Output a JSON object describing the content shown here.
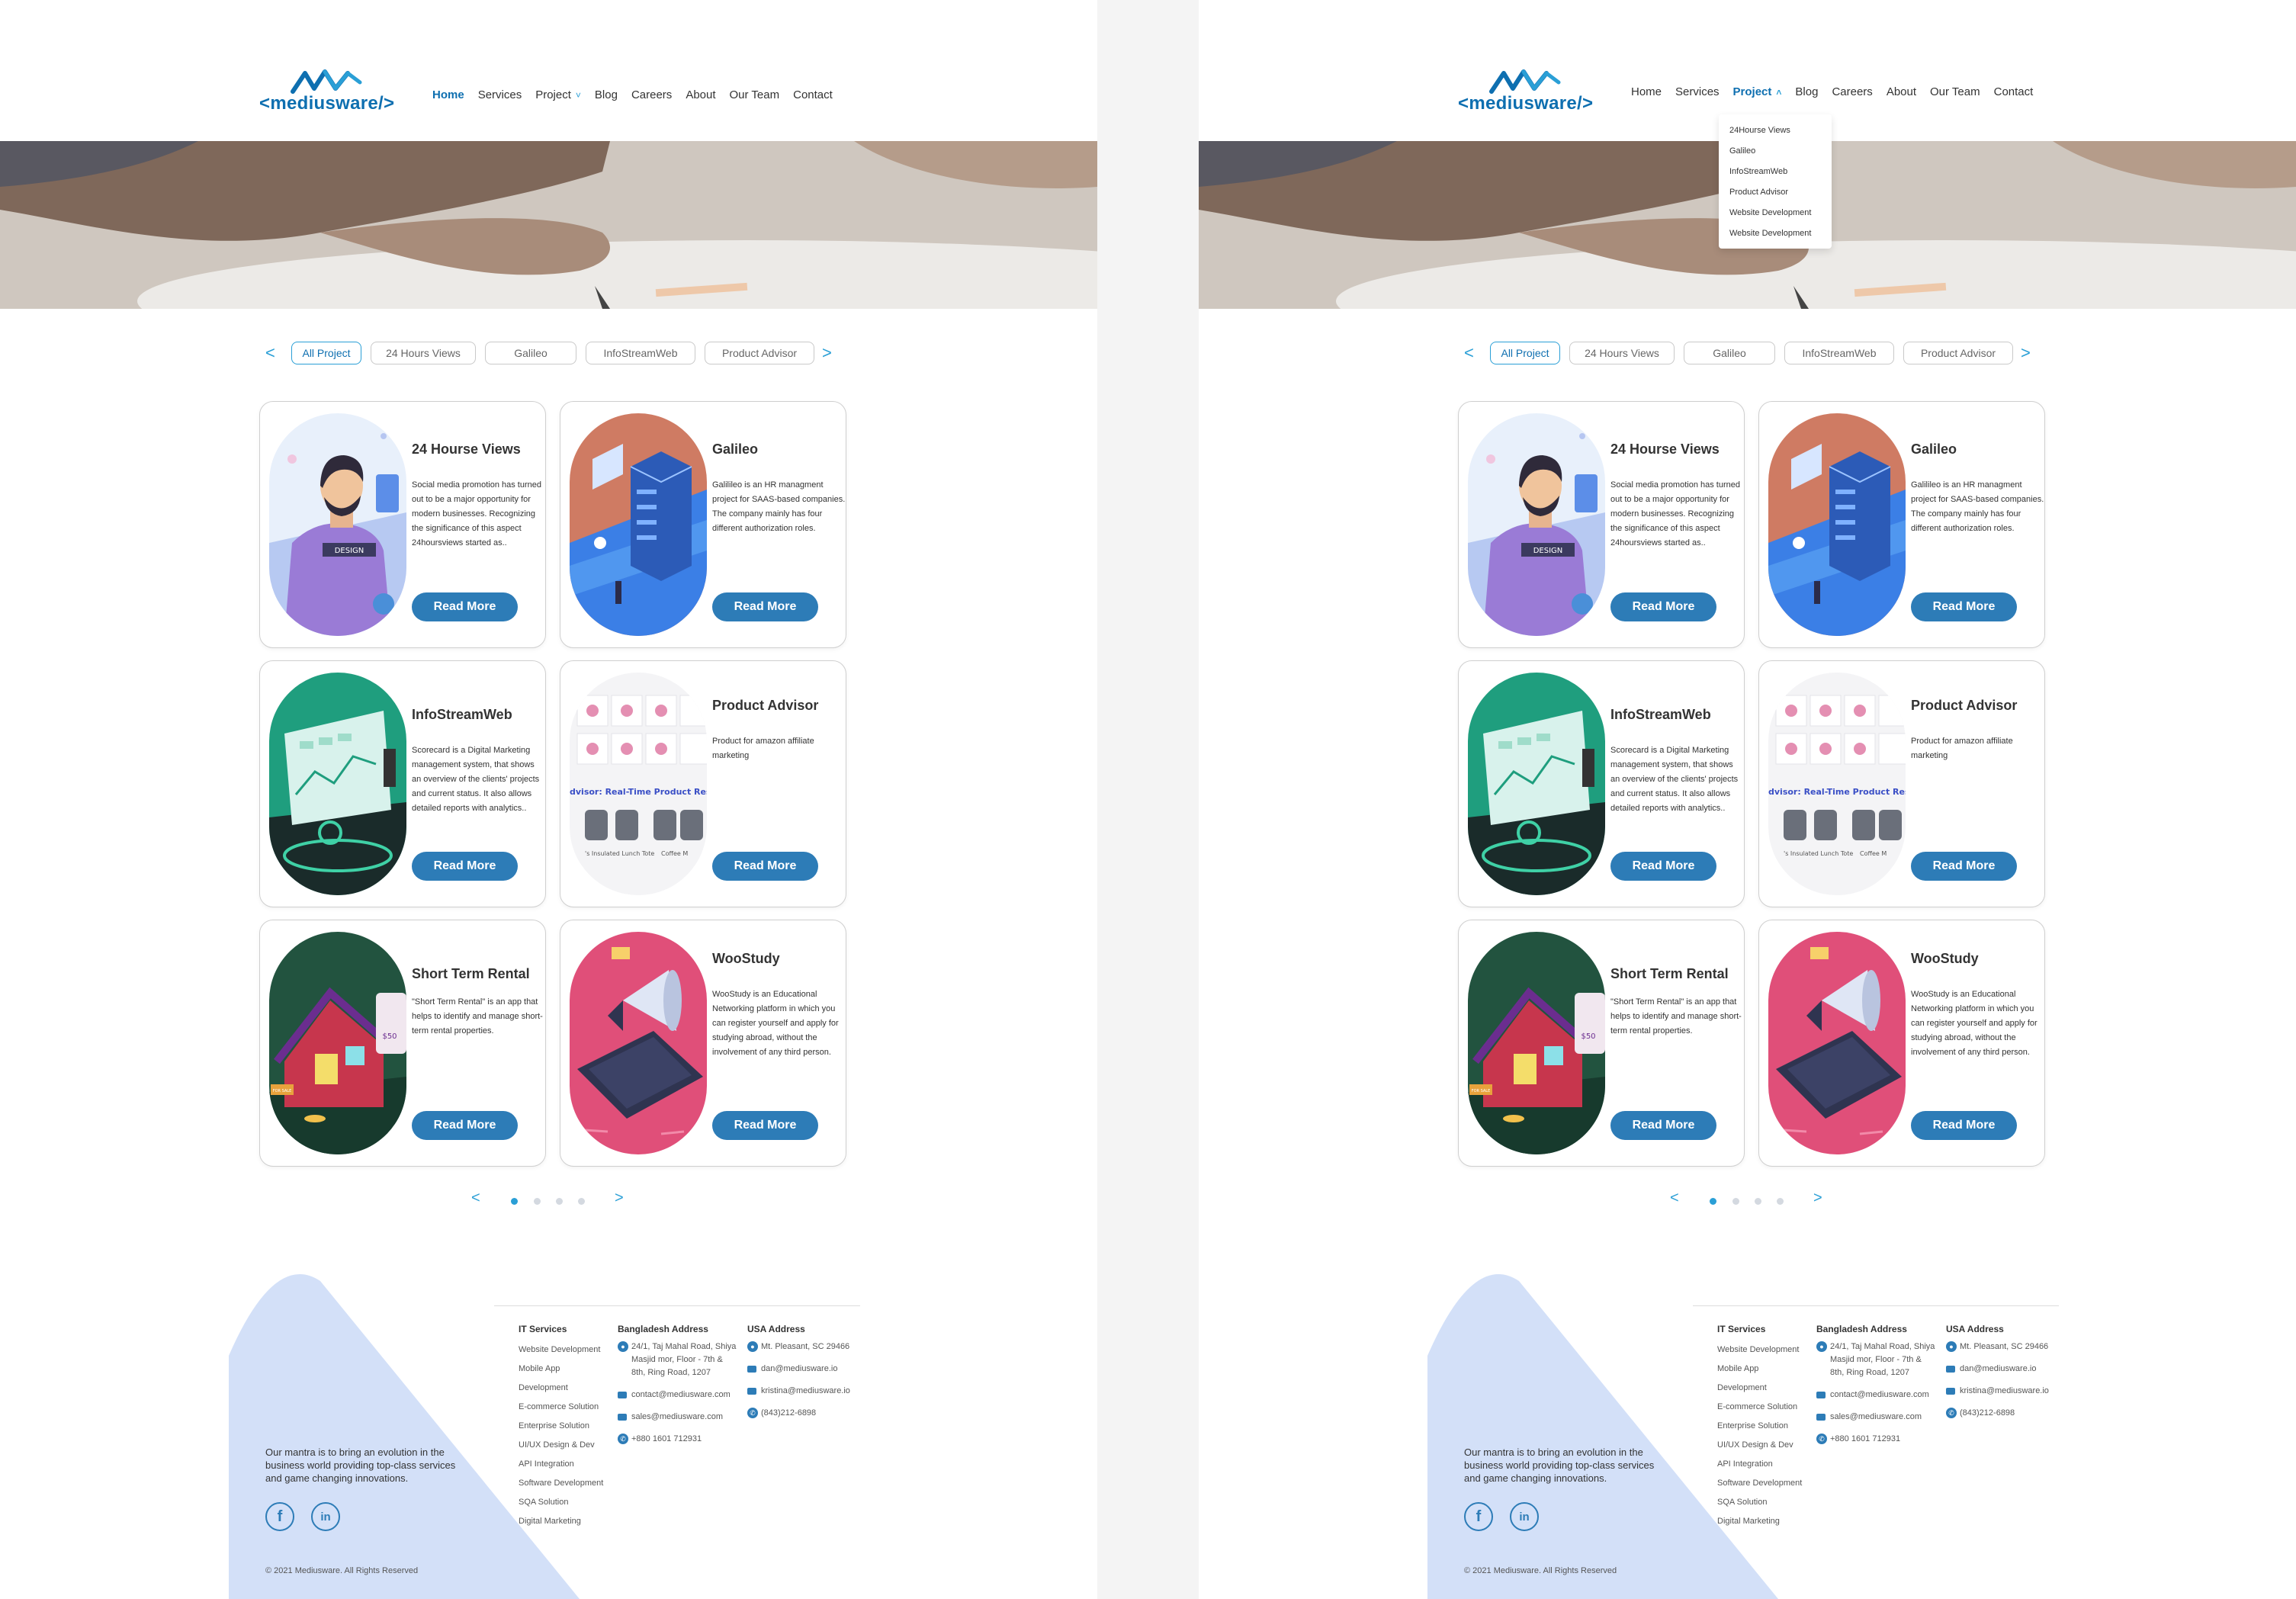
{
  "brand": {
    "logo_text": "<mediusware/>"
  },
  "nav": [
    {
      "label": "Home"
    },
    {
      "label": "Services"
    },
    {
      "label": "Project"
    },
    {
      "label": "Blog"
    },
    {
      "label": "Careers"
    },
    {
      "label": "About"
    },
    {
      "label": "Our Team"
    },
    {
      "label": "Contact"
    }
  ],
  "project_dropdown": [
    "24Hourse Views",
    "Galileo",
    "InfoStreamWeb",
    "Product Advisor",
    "Website Development",
    "Website Development"
  ],
  "filter": {
    "prev_arrow": "<",
    "next_arrow": ">",
    "tabs": [
      "All Project",
      "24 Hours Views",
      "Galileo",
      "InfoStreamWeb",
      "Product Advisor"
    ]
  },
  "cards": [
    {
      "title": "24 Hourse Views",
      "desc": "Social media promotion has turned out to be a major opportunity for modern businesses. Recognizing the significance of this aspect 24hoursviews started as..",
      "button": "Read More",
      "image_icon": "design-person-illustration",
      "badge_text": "DESIGN"
    },
    {
      "title": "Galileo",
      "desc": "Galilileo is an HR managment project for SAAS-based companies. The company mainly has four different authorization roles.",
      "button": "Read More",
      "image_icon": "server-isometric-illustration"
    },
    {
      "title": "InfoStreamWeb",
      "desc": "Scorecard is a Digital Marketing management system, that shows an overview of the clients' projects and current status. It also allows detailed reports with analytics..",
      "button": "Read More",
      "image_icon": "analytics-dashboard-illustration"
    },
    {
      "title": "Product Advisor",
      "desc": "Product for amazon affiliate marketing",
      "button": "Read More",
      "image_icon": "product-research-screenshot",
      "shot_text": "dvisor: Real-Time Product Research",
      "shot_caption_1": "'s Insulated Lunch Tote",
      "shot_caption_2": "Coffee M"
    },
    {
      "title": "Short Term Rental",
      "desc": "\"Short Term Rental\" is an app that helps to identify and manage short-term rental properties.",
      "button": "Read More",
      "image_icon": "house-rental-illustration",
      "sign_text": "FOR SALE",
      "price_text": "$50"
    },
    {
      "title": "WooStudy",
      "desc": "WooStudy is an Educational Networking platform in which you can register yourself and apply for studying abroad, without the involvement of any third person.",
      "button": "Read More",
      "image_icon": "megaphone-phone-illustration"
    }
  ],
  "pager": {
    "prev": "<",
    "next": ">",
    "pages": 4,
    "current": 1
  },
  "footer": {
    "mantra": "Our mantra is to bring an evolution in the business world providing top-class services and game changing innovations.",
    "facebook_icon": "f",
    "linkedin_icon": "in",
    "copyright": "© 2021 Mediusware. All Rights Reserved",
    "it_services": {
      "title": "IT Services",
      "items": [
        "Website Development",
        "Mobile App",
        "Development",
        "E-commerce Solution",
        "Enterprise Solution",
        "UI/UX Design & Dev",
        "API Integration",
        "Software Development",
        "SQA Solution",
        "Digital Marketing"
      ]
    },
    "bangladesh": {
      "title": "Bangladesh Address",
      "address": "24/1, Taj Mahal Road, Shiya Masjid mor, Floor - 7th & 8th, Ring Road, 1207",
      "email1": "contact@mediusware.com",
      "email2": "sales@mediusware.com",
      "phone": "+880 1601 712931"
    },
    "usa": {
      "title": "USA Address",
      "address": "Mt. Pleasant, SC 29466",
      "email1": "dan@mediusware.io",
      "email2": "kristina@mediusware.io",
      "phone": "(843)212-6898"
    }
  },
  "colors": {
    "primary": "#2d7cb7",
    "accent": "#2a9fd6",
    "brand": "#0e6fb0",
    "footer_triangle": "#d3e0f8"
  }
}
